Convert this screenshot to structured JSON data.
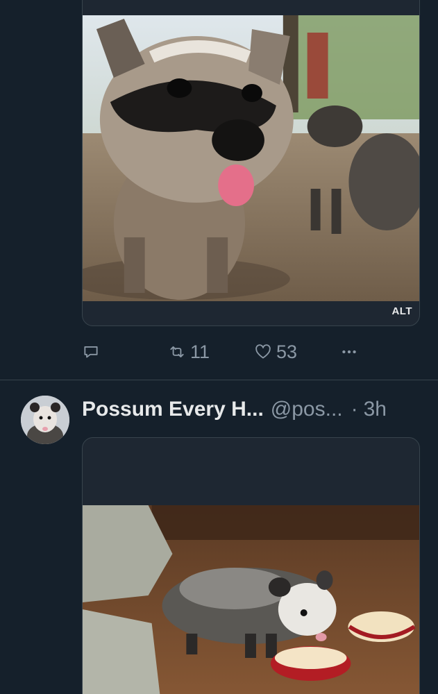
{
  "tweets": [
    {
      "media": {
        "alt_label": "ALT"
      },
      "actions": {
        "reply": {
          "icon": "reply-icon",
          "count": ""
        },
        "retweet": {
          "icon": "retweet-icon",
          "count": "11"
        },
        "like": {
          "icon": "heart-icon",
          "count": "53"
        },
        "more": {
          "icon": "more-icon"
        }
      }
    },
    {
      "author": {
        "name": "Possum Every H...",
        "handle": "@pos...",
        "separator": "·",
        "time": "3h"
      }
    }
  ],
  "colors": {
    "background": "#15202b",
    "card": "#1e2732",
    "border": "#38444d",
    "text": "#e7e9ea",
    "muted": "#8b98a5"
  }
}
